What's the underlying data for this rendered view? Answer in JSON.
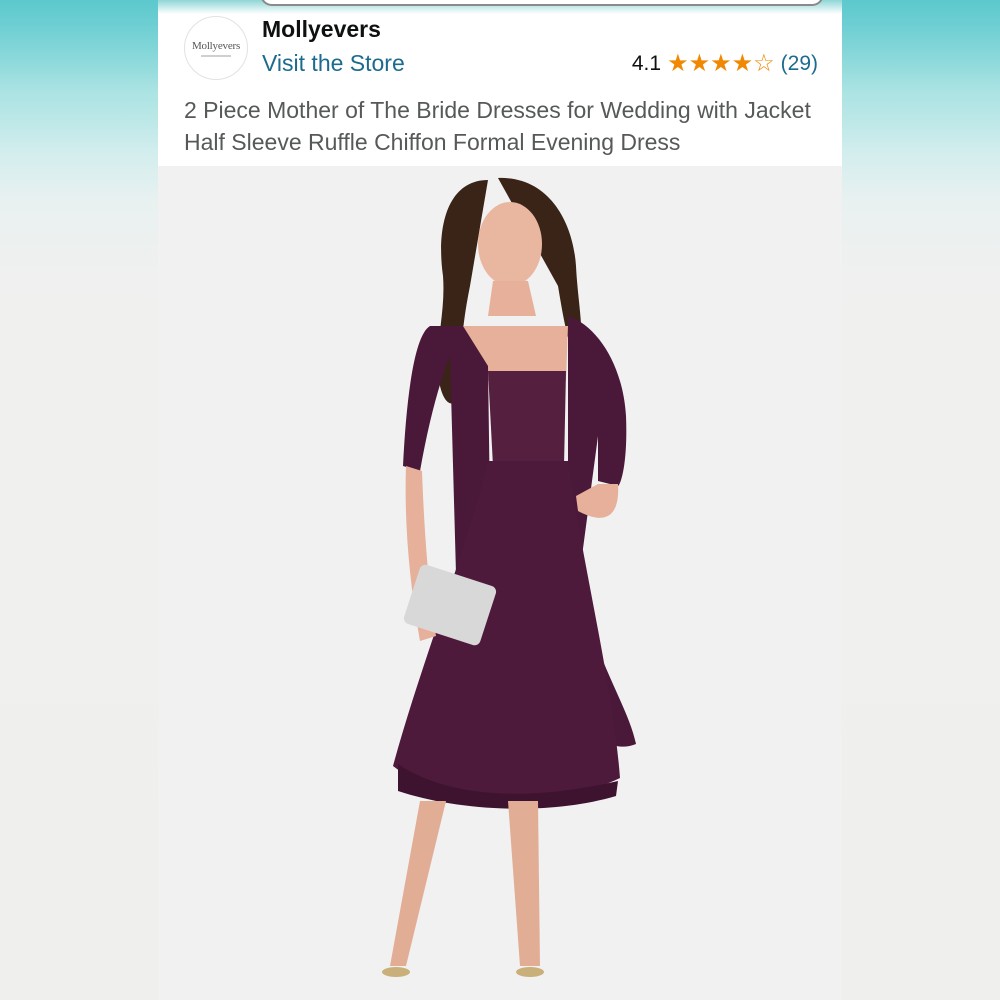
{
  "brand": {
    "logo_text": "Mollyevers",
    "name": "Mollyevers",
    "visit_store_label": "Visit the Store"
  },
  "rating": {
    "value": "4.1",
    "stars_filled": 4,
    "stars_total": 5,
    "review_count": "(29)"
  },
  "product": {
    "title": "2 Piece Mother of The Bride Dresses for Wedding with Jacket Half Sleeve Ruffle Chiffon Formal Evening Dress",
    "dress_color": "#4e1a3c",
    "image_background": "#f1f1f1"
  },
  "colors": {
    "link": "#1c6b8e",
    "star": "#f08804",
    "text_primary": "#0f1111",
    "text_secondary": "#565959"
  }
}
